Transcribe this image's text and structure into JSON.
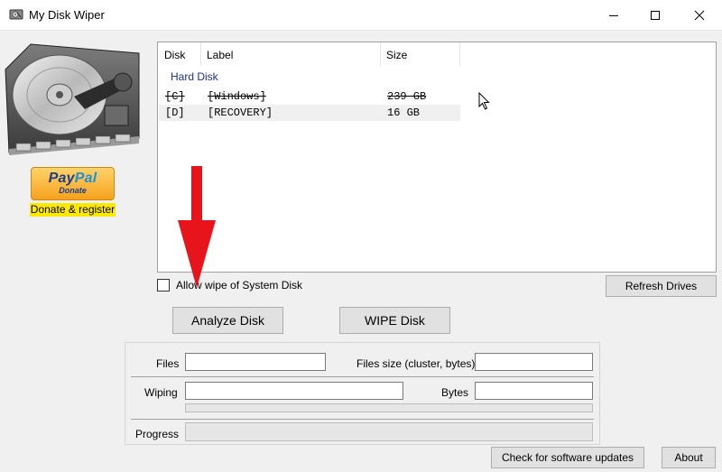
{
  "window": {
    "title": "My Disk Wiper"
  },
  "sidebar": {
    "paypal_word_a": "Pay",
    "paypal_word_b": "Pal",
    "paypal_sub": "Donate",
    "donate_link": "Donate & register"
  },
  "disk_list": {
    "columns": [
      "Disk",
      "Label",
      "Size"
    ],
    "group": "Hard Disk",
    "rows": [
      {
        "disk": "[C]",
        "label": "[Windows]",
        "size": "239 GB",
        "struck": true
      },
      {
        "disk": "[D]",
        "label": "[RECOVERY]",
        "size": "16 GB",
        "struck": false
      }
    ]
  },
  "controls": {
    "allow_system_wipe": "Allow wipe of System Disk",
    "allow_system_wipe_checked": false,
    "refresh": "Refresh Drives",
    "analyze": "Analyze Disk",
    "wipe": "WIPE Disk"
  },
  "stats": {
    "files_label": "Files",
    "files_value": "",
    "files_size_label": "Files size (cluster, bytes)",
    "files_size_value": "",
    "wiping_label": "Wiping",
    "wiping_value": "",
    "bytes_label": "Bytes",
    "bytes_value": "",
    "progress_label": "Progress",
    "wiping_progress": 0,
    "overall_progress": 0
  },
  "footer": {
    "updates": "Check for software updates",
    "about": "About"
  },
  "colors": {
    "annotation_arrow": "#e8141c",
    "group_header": "#1e3287",
    "donate_highlight": "#ffe900"
  }
}
